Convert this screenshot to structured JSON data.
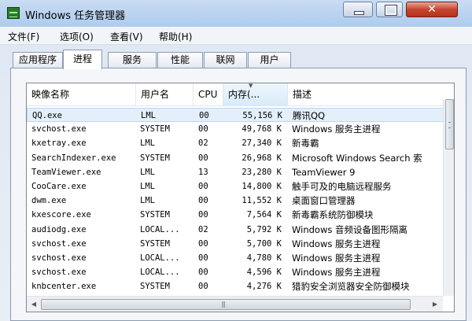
{
  "window": {
    "title": "Windows 任务管理器"
  },
  "menu": [
    "文件(F)",
    "选项(O)",
    "查看(V)",
    "帮助(H)"
  ],
  "tabs": [
    "应用程序",
    "进程",
    "服务",
    "性能",
    "联网",
    "用户"
  ],
  "active_tab": "进程",
  "columns": [
    "映像名称",
    "用户名",
    "CPU",
    "内存(...",
    "描述"
  ],
  "sorted_column": "内存(...",
  "rows": [
    {
      "name": "QQ.exe",
      "user": "LML",
      "cpu": "00",
      "mem": "55,156 K",
      "desc": "腾讯QQ"
    },
    {
      "name": "svchost.exe",
      "user": "SYSTEM",
      "cpu": "00",
      "mem": "49,768 K",
      "desc": "Windows 服务主进程"
    },
    {
      "name": "kxetray.exe",
      "user": "LML",
      "cpu": "02",
      "mem": "27,340 K",
      "desc": "新毒霸"
    },
    {
      "name": "SearchIndexer.exe",
      "user": "SYSTEM",
      "cpu": "00",
      "mem": "26,968 K",
      "desc": "Microsoft Windows Search 索"
    },
    {
      "name": "TeamViewer.exe",
      "user": "LML",
      "cpu": "13",
      "mem": "23,280 K",
      "desc": "TeamViewer 9"
    },
    {
      "name": "CooCare.exe",
      "user": "LML",
      "cpu": "00",
      "mem": "14,800 K",
      "desc": "触手可及的电脑远程服务"
    },
    {
      "name": "dwm.exe",
      "user": "LML",
      "cpu": "00",
      "mem": "11,552 K",
      "desc": "桌面窗口管理器"
    },
    {
      "name": "kxescore.exe",
      "user": "SYSTEM",
      "cpu": "00",
      "mem": "7,564 K",
      "desc": "新毒霸系统防御模块"
    },
    {
      "name": "audiodg.exe",
      "user": "LOCAL...",
      "cpu": "02",
      "mem": "5,792 K",
      "desc": "Windows 音频设备图形隔离"
    },
    {
      "name": "svchost.exe",
      "user": "SYSTEM",
      "cpu": "00",
      "mem": "5,700 K",
      "desc": "Windows 服务主进程"
    },
    {
      "name": "svchost.exe",
      "user": "LOCAL...",
      "cpu": "00",
      "mem": "4,780 K",
      "desc": "Windows 服务主进程"
    },
    {
      "name": "svchost.exe",
      "user": "LOCAL...",
      "cpu": "00",
      "mem": "4,596 K",
      "desc": "Windows 服务主进程"
    },
    {
      "name": "knbcenter.exe",
      "user": "SYSTEM",
      "cpu": "00",
      "mem": "4,276 K",
      "desc": "猎豹安全浏览器安全防御模块"
    }
  ]
}
